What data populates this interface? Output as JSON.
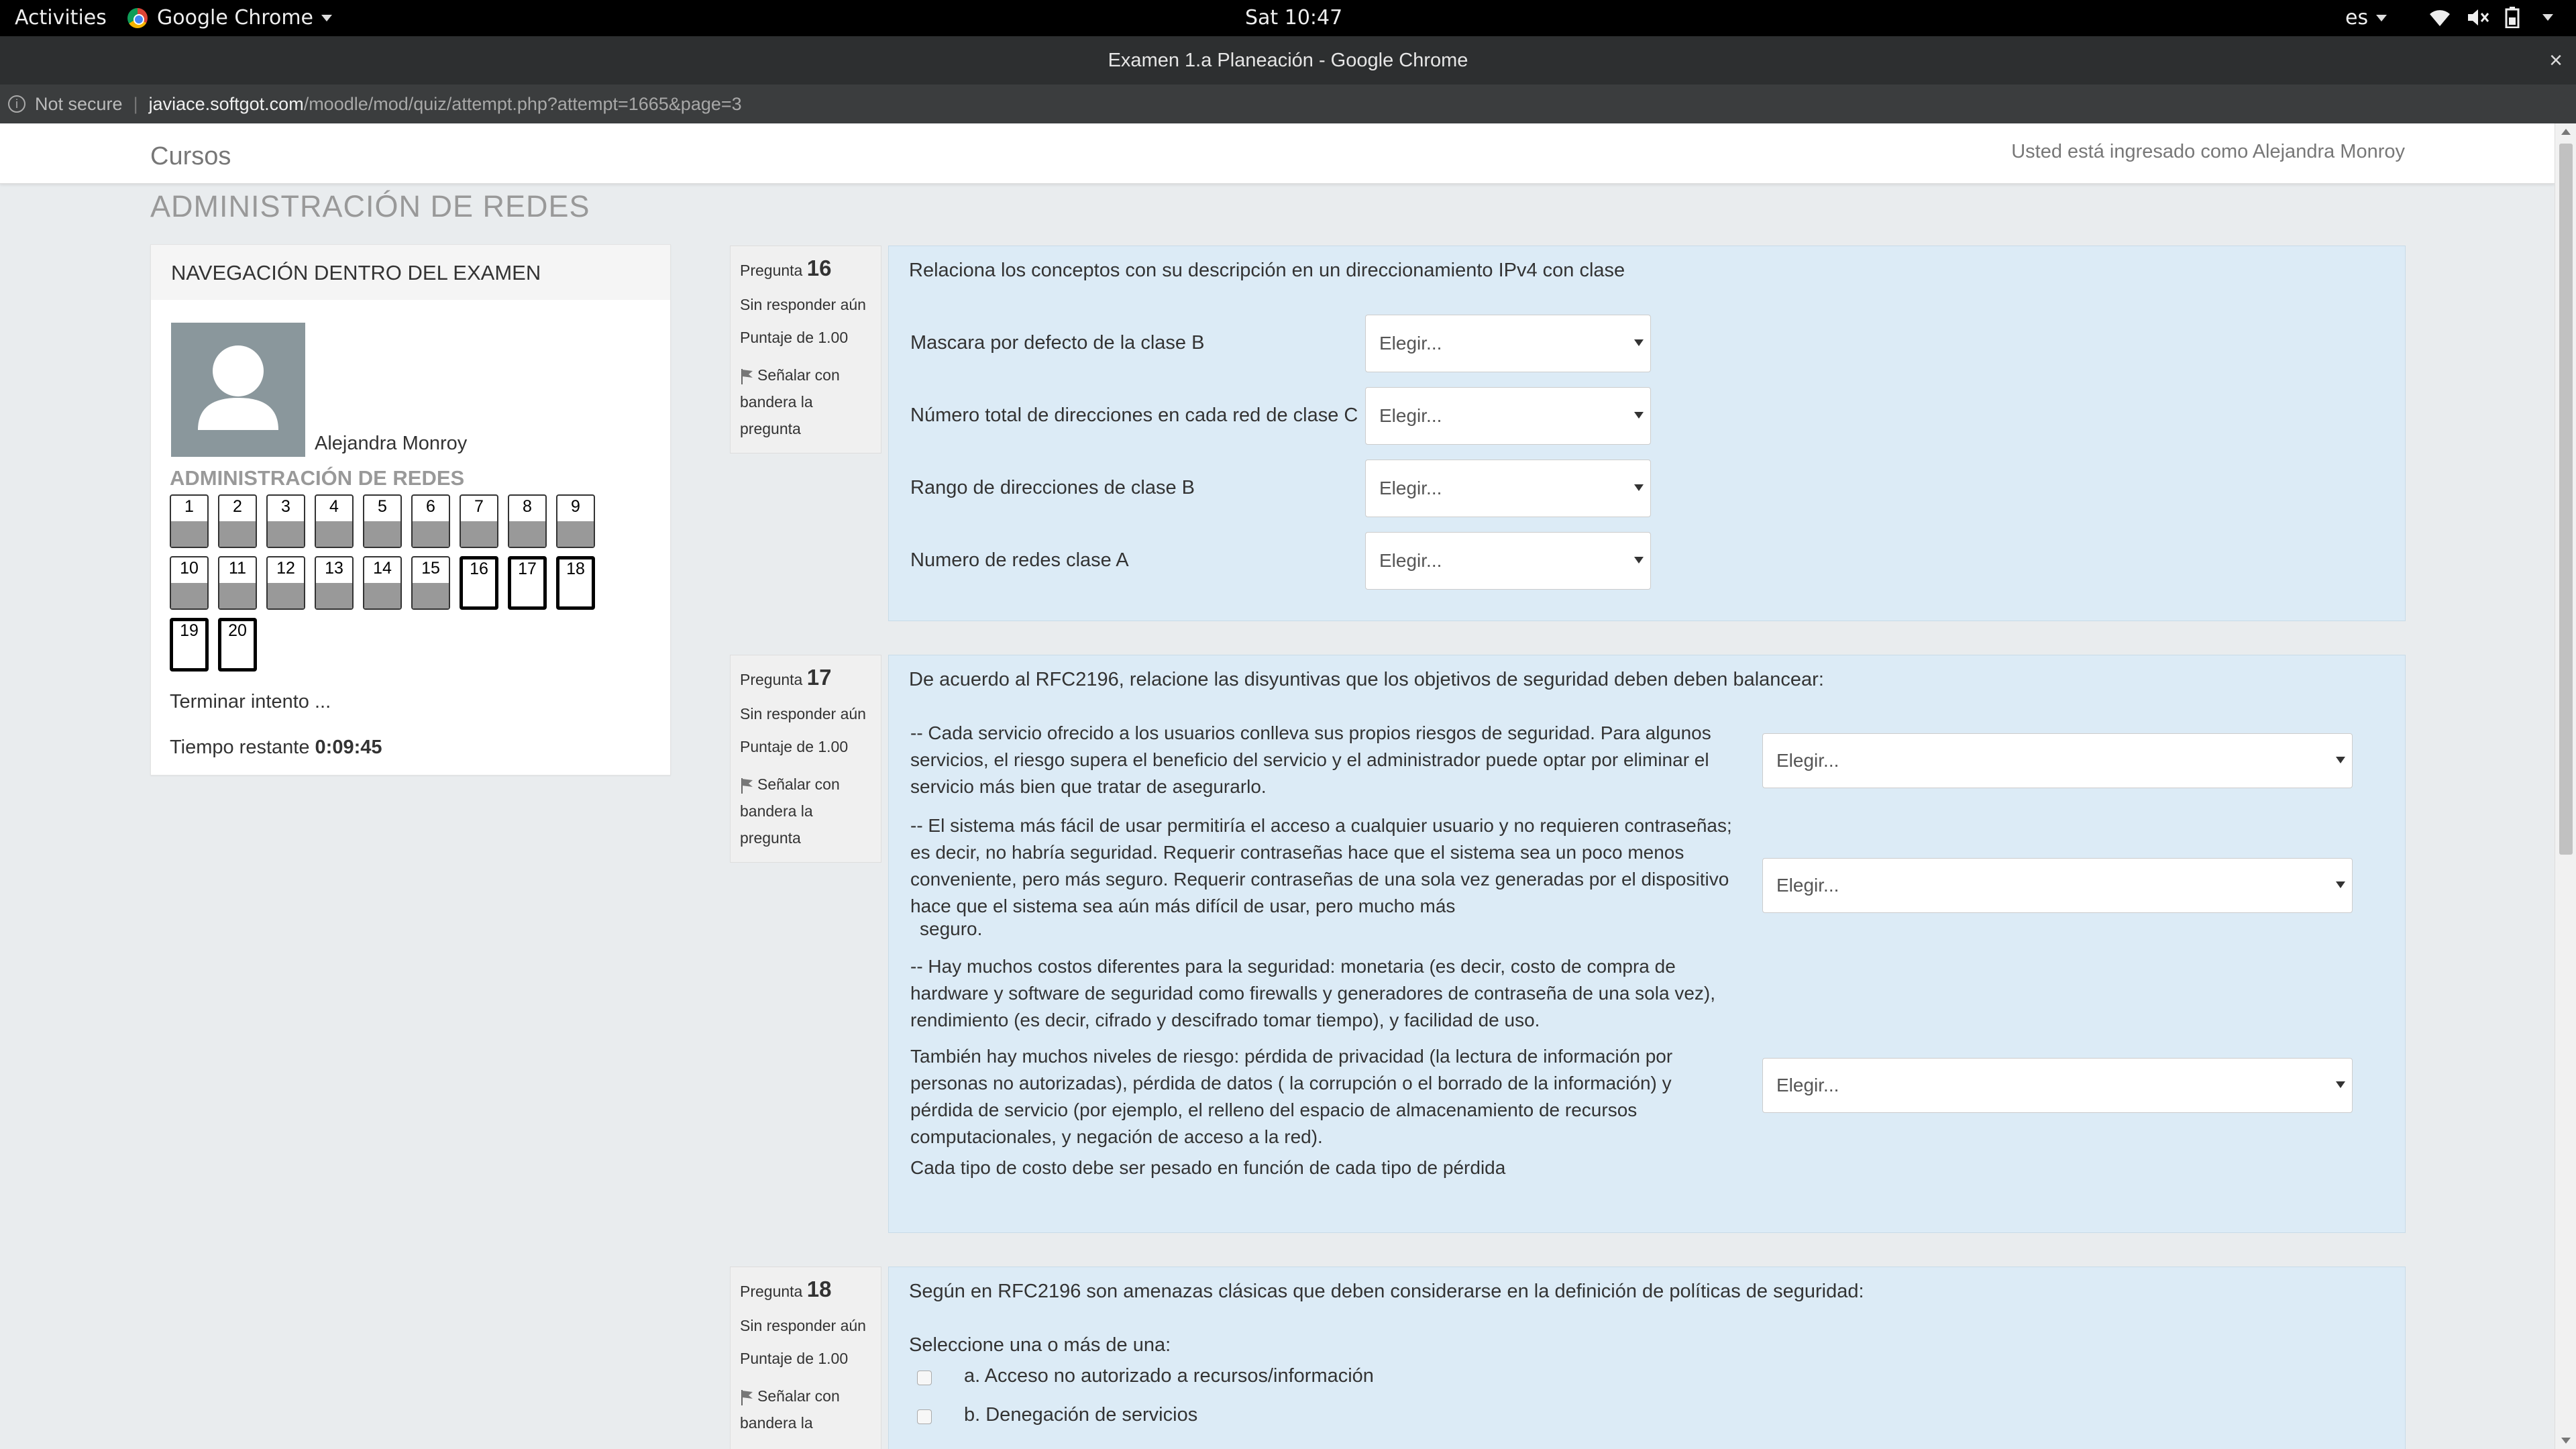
{
  "system": {
    "activities": "Activities",
    "app_name": "Google Chrome",
    "clock": "Sat 10:47",
    "lang": "es"
  },
  "browser": {
    "window_title": "Examen 1.a Planeación - Google Chrome",
    "close": "×",
    "security": "Not secure",
    "url_host": "javiace.softgot.com",
    "url_path": "/moodle/mod/quiz/attempt.php?attempt=1665&page=3"
  },
  "navbar": {
    "brand": "Cursos",
    "login_info": "Usted está ingresado como Alejandra Monroy"
  },
  "course_heading": "ADMINISTRACIÓN DE REDES",
  "quiz_nav": {
    "title": "NAVEGACIÓN DENTRO DEL EXAMEN",
    "user_name": "Alejandra Monroy",
    "section": "ADMINISTRACIÓN DE REDES",
    "questions": [
      "1",
      "2",
      "3",
      "4",
      "5",
      "6",
      "7",
      "8",
      "9",
      "10",
      "11",
      "12",
      "13",
      "14",
      "15",
      "16",
      "17",
      "18",
      "19",
      "20"
    ],
    "answered_count": 15,
    "finish": "Terminar intento ...",
    "time_label": "Tiempo restante",
    "time_value": "0:09:45"
  },
  "q16": {
    "label": "Pregunta",
    "number": "16",
    "status": "Sin responder aún",
    "grade": "Puntaje de 1.00",
    "flag_line1": "Señalar con",
    "flag_line2": "bandera la",
    "flag_line3": "pregunta",
    "text": "Relaciona los conceptos con su descripción en un direccionamiento IPv4 con clase",
    "rows": [
      {
        "label": "Mascara por defecto de la clase B",
        "select": "Elegir..."
      },
      {
        "label": "Número total de direcciones en cada red de clase C",
        "select": "Elegir..."
      },
      {
        "label": "Rango de direcciones de clase B",
        "select": "Elegir..."
      },
      {
        "label": "Numero de redes clase A",
        "select": "Elegir..."
      }
    ]
  },
  "q17": {
    "label": "Pregunta",
    "number": "17",
    "status": "Sin responder aún",
    "grade": "Puntaje de 1.00",
    "flag_line1": "Señalar con",
    "flag_line2": "bandera la",
    "flag_line3": "pregunta",
    "text": "De acuerdo al RFC2196, relacione las disyuntivas que los objetivos de seguridad deben deben balancear:",
    "p1": [
      "-- Cada servicio ofrecido a los usuarios conlleva sus propios riesgos de seguridad. Para algunos",
      "servicios, el riesgo supera el beneficio del servicio y el administrador puede optar por eliminar el",
      "servicio más bien que tratar de asegurarlo."
    ],
    "p2": [
      "-- El sistema más fácil de usar permitiría el acceso a cualquier usuario y no requieren contraseñas;",
      "es decir, no habría seguridad. Requerir contraseñas hace que el sistema sea un poco menos",
      "conveniente, pero más seguro. Requerir contraseñas de una sola vez generadas por el dispositivo",
      "hace que el sistema sea aún más difícil de usar, pero mucho más"
    ],
    "p2_tail": "seguro.",
    "p3": [
      "-- Hay muchos costos diferentes para la seguridad: monetaria (es decir, costo de compra de",
      "hardware y software de seguridad como firewalls y generadores de contraseña de una sola vez),",
      "rendimiento (es decir, cifrado y descifrado tomar tiempo), y facilidad de uso."
    ],
    "p4": [
      "También hay muchos niveles de riesgo: pérdida de privacidad (la  lectura de información por",
      "personas no autorizadas), pérdida de datos ( la corrupción o el borrado de la información) y",
      " pérdida de servicio (por ejemplo, el relleno del espacio de almacenamiento de recursos",
      "computacionales, y negación de acceso a la red)."
    ],
    "p5": "Cada  tipo de costo debe ser pesado en función de cada tipo de pérdida",
    "selects": [
      "Elegir...",
      "Elegir...",
      "Elegir..."
    ]
  },
  "q18": {
    "label": "Pregunta",
    "number": "18",
    "status": "Sin responder aún",
    "grade": "Puntaje de 1.00",
    "flag_line1": "Señalar con",
    "flag_line2": "bandera la",
    "text": "Según en RFC2196 son amenazas clásicas que deben considerarse en la definición de políticas de seguridad:",
    "prompt": "Seleccione una o más de una:",
    "options": [
      "a. Acceso no autorizado a recursos/información",
      "b. Denegación de servicios"
    ]
  }
}
